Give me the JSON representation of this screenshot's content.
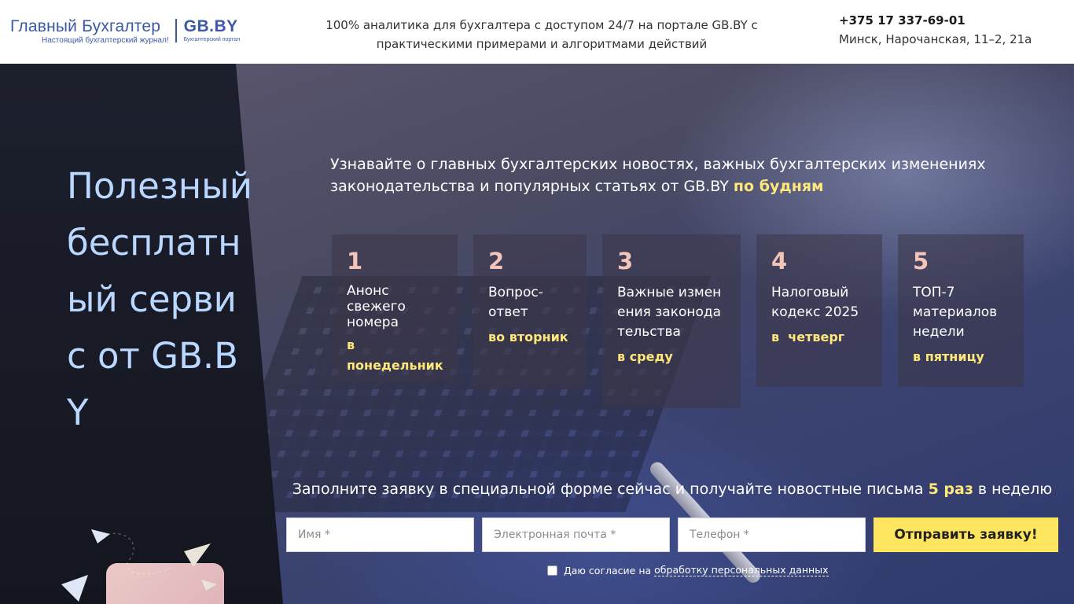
{
  "header": {
    "logo_main": "Главный Бухгалтер",
    "logo_sub": "Настоящий бухгалтерский журнал!",
    "logo_gb": "GB.BY",
    "logo_gb_sub": "Бухгалтерский портал",
    "tagline": "100% аналитика для бухгалтера с доступом 24/7 на портале GB.BY с практическими примерами и алгоритмами действий",
    "phone": "+375 17 337-69-01",
    "address": "Минск, Нарочанская, 11–2, 21а"
  },
  "hero": {
    "title": "Полезный бесплатный сервис от GB.BY",
    "intro_text": "Узнавайте о главных бухгалтерских новостях, важных бухгалтерских изменениях законодательства и популярных статьях от GB.BY ",
    "intro_highlight": "по будням"
  },
  "cards": [
    {
      "num": "1",
      "title": "Анонс свежего номера",
      "day": "в понедельник"
    },
    {
      "num": "2",
      "title": "Вопрос-ответ",
      "day": "во вторник"
    },
    {
      "num": "3",
      "title": "Важные изменения законодательства",
      "day": "в среду"
    },
    {
      "num": "4",
      "title": "Налоговый кодекс 2025",
      "day": "в  четверг"
    },
    {
      "num": "5",
      "title": "ТОП-7 материалов недели",
      "day": "в пятницу"
    }
  ],
  "form": {
    "heading_pre": "Заполните заявку в специальной форме сейчас и получайте новостные письма ",
    "heading_bold": "5 раз",
    "heading_post": " в неделю",
    "name_placeholder": "Имя *",
    "email_placeholder": "Электронная почта *",
    "phone_placeholder": "Телефон *",
    "submit_label": "Отправить заявку!",
    "consent_text": "Даю согласие на",
    "consent_link": "обработку персональных данных"
  },
  "colors": {
    "accent_yellow": "#ffe55d",
    "title_blue": "#b9d7ff",
    "brand_blue": "#3a5aa8"
  }
}
